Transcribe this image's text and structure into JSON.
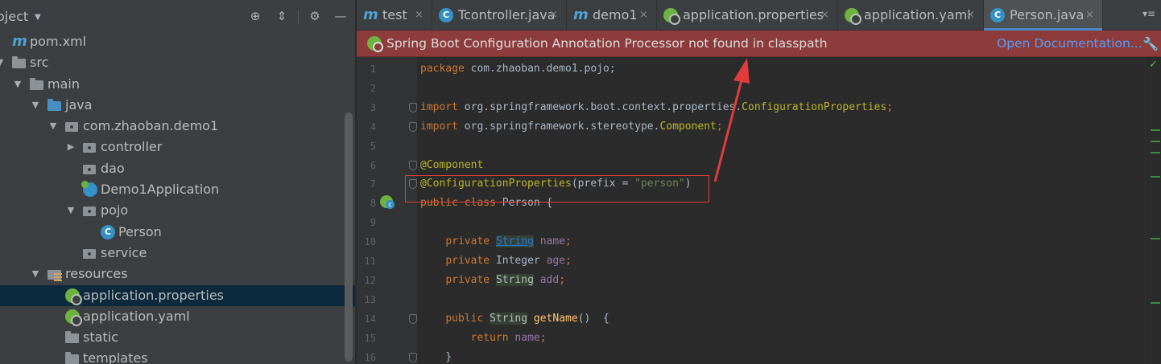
{
  "project_panel": {
    "title": "oject",
    "header_icons": [
      "target-icon",
      "collapse-all-icon",
      "gear-icon",
      "minimize-icon"
    ],
    "tree": [
      {
        "label": "pom.xml",
        "icon": "maven-icon",
        "level": 0,
        "arrow": ""
      },
      {
        "label": "src",
        "icon": "folder-icon",
        "level": 0,
        "arrow": "open"
      },
      {
        "label": "main",
        "icon": "folder-icon",
        "level": 1,
        "arrow": "open"
      },
      {
        "label": "java",
        "icon": "source-folder-icon",
        "level": 2,
        "arrow": "open"
      },
      {
        "label": "com.zhaoban.demo1",
        "icon": "package-icon",
        "level": 3,
        "arrow": "open"
      },
      {
        "label": "controller",
        "icon": "package-icon",
        "level": 4,
        "arrow": "closed"
      },
      {
        "label": "dao",
        "icon": "package-icon",
        "level": 4,
        "arrow": ""
      },
      {
        "label": "Demo1Application",
        "icon": "spring-app-icon",
        "level": 4,
        "arrow": ""
      },
      {
        "label": "pojo",
        "icon": "package-icon",
        "level": 4,
        "arrow": "open"
      },
      {
        "label": "Person",
        "icon": "class-icon",
        "level": 5,
        "arrow": ""
      },
      {
        "label": "service",
        "icon": "package-icon",
        "level": 4,
        "arrow": ""
      },
      {
        "label": "resources",
        "icon": "resources-folder-icon",
        "level": 2,
        "arrow": "open"
      },
      {
        "label": "application.properties",
        "icon": "spring-config-icon",
        "level": 3,
        "arrow": "",
        "selected": true
      },
      {
        "label": "application.yaml",
        "icon": "spring-config-icon",
        "level": 3,
        "arrow": ""
      },
      {
        "label": "static",
        "icon": "folder-icon",
        "level": 3,
        "arrow": ""
      },
      {
        "label": "templates",
        "icon": "folder-icon",
        "level": 3,
        "arrow": ""
      }
    ]
  },
  "tabs": [
    {
      "label": "test",
      "icon": "maven-icon",
      "active": false
    },
    {
      "label": "Tcontroller.java",
      "icon": "class-icon",
      "active": false
    },
    {
      "label": "demo1",
      "icon": "maven-icon",
      "active": false
    },
    {
      "label": "application.properties",
      "icon": "spring-config-icon",
      "active": false
    },
    {
      "label": "application.yaml",
      "icon": "spring-config-icon",
      "active": false
    },
    {
      "label": "Person.java",
      "icon": "class-icon",
      "active": true
    }
  ],
  "tab_close_glyph": "×",
  "tabs_menu_label": "▾≡",
  "banner": {
    "message": "Spring Boot Configuration Annotation Processor not found in classpath",
    "link": "Open Documentation...",
    "settings_icon": "wrench-icon"
  },
  "code_lines": [
    {
      "num": "1",
      "tokens": [
        [
          "kw",
          "package "
        ],
        [
          "plain",
          "com.zhaoban.demo1.pojo;"
        ]
      ]
    },
    {
      "num": "2",
      "tokens": []
    },
    {
      "num": "3",
      "tokens": [
        [
          "kw",
          "import "
        ],
        [
          "plain",
          "org.springframework.boot.context.properties."
        ],
        [
          "ann",
          "ConfigurationProperties"
        ],
        [
          "kw",
          ";"
        ]
      ],
      "fold": true
    },
    {
      "num": "4",
      "tokens": [
        [
          "kw",
          "import "
        ],
        [
          "plain",
          "org.springframework.stereotype."
        ],
        [
          "ann",
          "Component"
        ],
        [
          "kw",
          ";"
        ]
      ],
      "fold": true
    },
    {
      "num": "5",
      "tokens": []
    },
    {
      "num": "6",
      "tokens": [
        [
          "ann",
          "@Component"
        ]
      ],
      "fold": true
    },
    {
      "num": "7",
      "tokens": [
        [
          "ann",
          "@ConfigurationProperties"
        ],
        [
          "plain",
          "(prefix = "
        ],
        [
          "str",
          "\"person\""
        ],
        [
          "plain",
          ")"
        ]
      ],
      "fold": true
    },
    {
      "num": "8",
      "tokens": [
        [
          "kw",
          "public class "
        ],
        [
          "plain",
          "Person {"
        ]
      ]
    },
    {
      "num": "9",
      "tokens": []
    },
    {
      "num": "10",
      "tokens": [
        [
          "plain",
          "    "
        ],
        [
          "kw",
          "private "
        ],
        [
          "type-ul",
          "String"
        ],
        [
          "plain",
          " "
        ],
        [
          "fld",
          "name"
        ],
        [
          "kw",
          ";"
        ]
      ]
    },
    {
      "num": "11",
      "tokens": [
        [
          "plain",
          "    "
        ],
        [
          "kw",
          "private "
        ],
        [
          "plain",
          "Integer "
        ],
        [
          "fld",
          "age"
        ],
        [
          "kw",
          ";"
        ]
      ]
    },
    {
      "num": "12",
      "tokens": [
        [
          "plain",
          "    "
        ],
        [
          "kw",
          "private "
        ],
        [
          "type-hl",
          "String"
        ],
        [
          "plain",
          " "
        ],
        [
          "fld",
          "add"
        ],
        [
          "kw",
          ";"
        ]
      ]
    },
    {
      "num": "13",
      "tokens": []
    },
    {
      "num": "14",
      "tokens": [
        [
          "plain",
          "    "
        ],
        [
          "kw",
          "public "
        ],
        [
          "type-hl",
          "String"
        ],
        [
          "plain",
          " "
        ],
        [
          "fn",
          "getName"
        ],
        [
          "plain",
          "()  {"
        ]
      ],
      "fold": true
    },
    {
      "num": "15",
      "tokens": [
        [
          "plain",
          "        "
        ],
        [
          "kw",
          "return "
        ],
        [
          "fld",
          "name"
        ],
        [
          "kw",
          ";"
        ]
      ]
    },
    {
      "num": "16",
      "tokens": [
        [
          "plain",
          "    }"
        ]
      ],
      "fold": true
    }
  ],
  "colors": {
    "banner_bg": "#8e3b3b",
    "link": "#589df6",
    "annotation_box": "#e23b3b",
    "arrow": "#e23b3b",
    "active_tab_underline": "#4a88c7"
  }
}
